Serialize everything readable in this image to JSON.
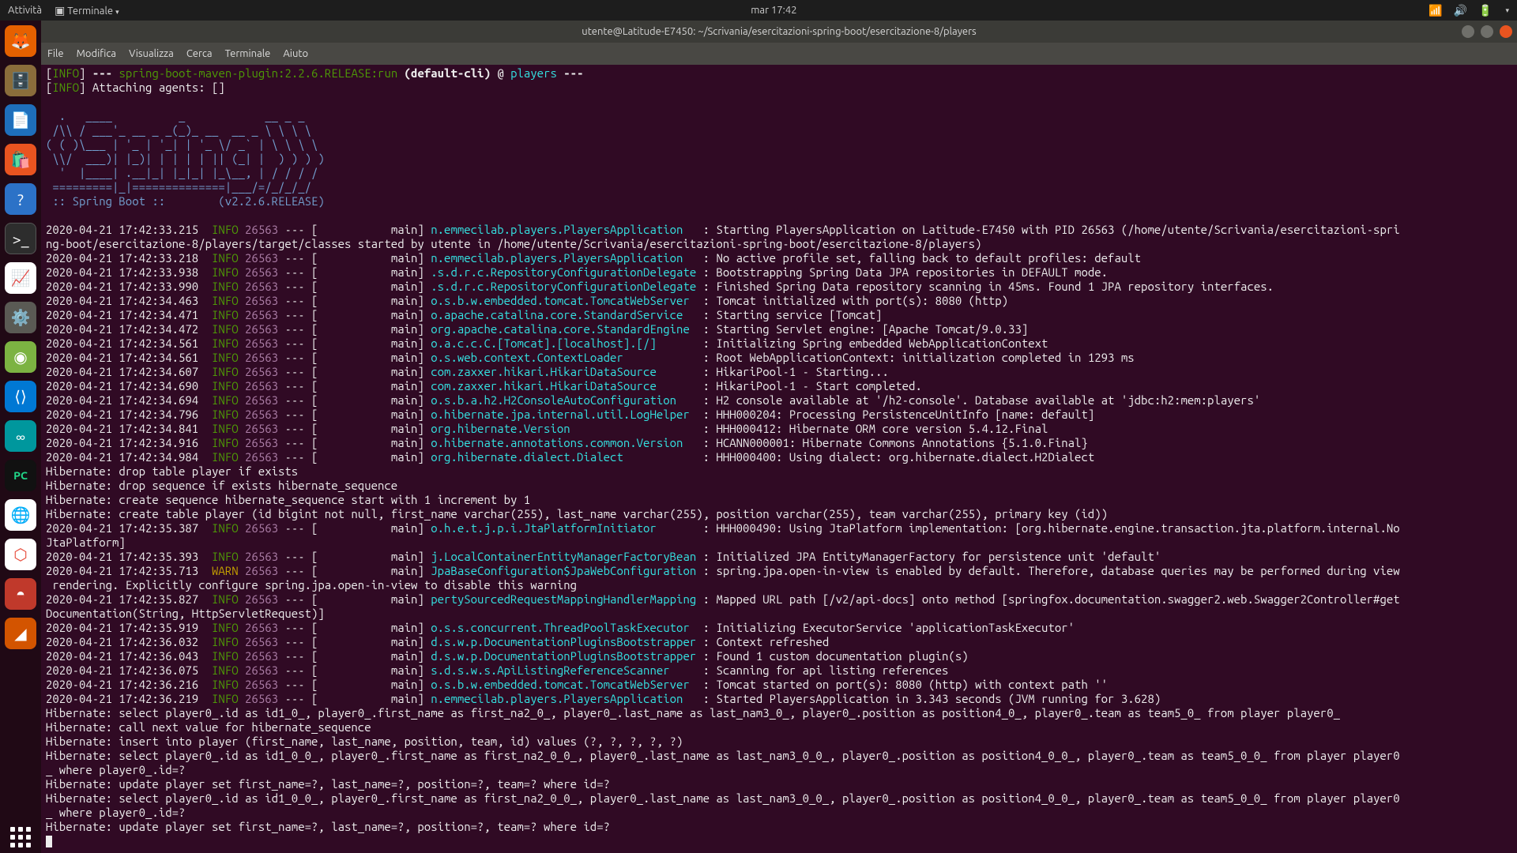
{
  "topbar": {
    "activities": "Attività",
    "terminal": "Terminale",
    "clock": "mar 17:42"
  },
  "dock": {
    "firefox": "firefox-icon",
    "files": "files-icon",
    "libreoffice": "libreoffice-writer-icon",
    "software": "ubuntu-software-icon",
    "help": "help-icon",
    "terminal": "terminal-icon",
    "monitor": "system-monitor-icon",
    "settings": "settings-icon",
    "green": "app-icon",
    "vscode": "vscode-icon",
    "arduino": "arduino-icon",
    "pycharm": "pycharm-icon",
    "chrome": "chrome-icon",
    "box": "app-icon-2",
    "red": "app-icon-3",
    "orange": "app-icon-4",
    "showapps": "show-applications-icon"
  },
  "window": {
    "title": "utente@Latitude-E7450: ~/Scrivania/esercitazioni-spring-boot/esercitazione-8/players",
    "controls": {
      "min": "−",
      "max": "□",
      "close": "×"
    }
  },
  "menubar": {
    "file": "File",
    "edit": "Modifica",
    "view": "Visualizza",
    "search": "Cerca",
    "terminal": "Terminale",
    "help": "Aiuto"
  },
  "term": {
    "l1a": "[",
    "l1b": "INFO",
    "l1c": "] ",
    "l1d": "--- ",
    "l1e": "spring-boot-maven-plugin:2.2.6.RELEASE:run",
    "l1f": " (default-cli)",
    "l1g": " @ ",
    "l1h": "players",
    "l1i": " ---",
    "l2a": "[",
    "l2b": "INFO",
    "l2c": "] Attaching agents: []",
    "banner": "\n  .   ____          _            __ _ _\n /\\\\ / ___'_ __ _ _(_)_ __  __ _ \\ \\ \\ \\\n( ( )\\___ | '_ | '_| | '_ \\/ _` | \\ \\ \\ \\\n \\\\/  ___)| |_)| | | | | || (_| |  ) ) ) )\n  '  |____| .__|_| |_|_| |_\\__, | / / / /\n =========|_|==============|___/=/_/_/_/",
    "bootline": " :: Spring Boot ::        (v2.2.6.RELEASE)",
    "lines": [
      {
        "ts": "2020-04-21 17:42:33.215",
        "lvl": "INFO",
        "pid": "26563",
        "th": " --- [           main] ",
        "log": "n.emmecilab.players.PlayersApplication   ",
        "msg": ": Starting PlayersApplication on Latitude-E7450 with PID 26563 (/home/utente/Scrivania/esercitazioni-spri"
      },
      {
        "plain": "ng-boot/esercitazione-8/players/target/classes started by utente in /home/utente/Scrivania/esercitazioni-spring-boot/esercitazione-8/players)"
      },
      {
        "ts": "2020-04-21 17:42:33.218",
        "lvl": "INFO",
        "pid": "26563",
        "th": " --- [           main] ",
        "log": "n.emmecilab.players.PlayersApplication   ",
        "msg": ": No active profile set, falling back to default profiles: default"
      },
      {
        "ts": "2020-04-21 17:42:33.938",
        "lvl": "INFO",
        "pid": "26563",
        "th": " --- [           main] ",
        "log": ".s.d.r.c.RepositoryConfigurationDelegate ",
        "msg": ": Bootstrapping Spring Data JPA repositories in DEFAULT mode."
      },
      {
        "ts": "2020-04-21 17:42:33.990",
        "lvl": "INFO",
        "pid": "26563",
        "th": " --- [           main] ",
        "log": ".s.d.r.c.RepositoryConfigurationDelegate ",
        "msg": ": Finished Spring Data repository scanning in 45ms. Found 1 JPA repository interfaces."
      },
      {
        "ts": "2020-04-21 17:42:34.463",
        "lvl": "INFO",
        "pid": "26563",
        "th": " --- [           main] ",
        "log": "o.s.b.w.embedded.tomcat.TomcatWebServer  ",
        "msg": ": Tomcat initialized with port(s): 8080 (http)"
      },
      {
        "ts": "2020-04-21 17:42:34.471",
        "lvl": "INFO",
        "pid": "26563",
        "th": " --- [           main] ",
        "log": "o.apache.catalina.core.StandardService   ",
        "msg": ": Starting service [Tomcat]"
      },
      {
        "ts": "2020-04-21 17:42:34.472",
        "lvl": "INFO",
        "pid": "26563",
        "th": " --- [           main] ",
        "log": "org.apache.catalina.core.StandardEngine  ",
        "msg": ": Starting Servlet engine: [Apache Tomcat/9.0.33]"
      },
      {
        "ts": "2020-04-21 17:42:34.561",
        "lvl": "INFO",
        "pid": "26563",
        "th": " --- [           main] ",
        "log": "o.a.c.c.C.[Tomcat].[localhost].[/]       ",
        "msg": ": Initializing Spring embedded WebApplicationContext"
      },
      {
        "ts": "2020-04-21 17:42:34.561",
        "lvl": "INFO",
        "pid": "26563",
        "th": " --- [           main] ",
        "log": "o.s.web.context.ContextLoader            ",
        "msg": ": Root WebApplicationContext: initialization completed in 1293 ms"
      },
      {
        "ts": "2020-04-21 17:42:34.607",
        "lvl": "INFO",
        "pid": "26563",
        "th": " --- [           main] ",
        "log": "com.zaxxer.hikari.HikariDataSource       ",
        "msg": ": HikariPool-1 - Starting..."
      },
      {
        "ts": "2020-04-21 17:42:34.690",
        "lvl": "INFO",
        "pid": "26563",
        "th": " --- [           main] ",
        "log": "com.zaxxer.hikari.HikariDataSource       ",
        "msg": ": HikariPool-1 - Start completed."
      },
      {
        "ts": "2020-04-21 17:42:34.694",
        "lvl": "INFO",
        "pid": "26563",
        "th": " --- [           main] ",
        "log": "o.s.b.a.h2.H2ConsoleAutoConfiguration    ",
        "msg": ": H2 console available at '/h2-console'. Database available at 'jdbc:h2:mem:players'"
      },
      {
        "ts": "2020-04-21 17:42:34.796",
        "lvl": "INFO",
        "pid": "26563",
        "th": " --- [           main] ",
        "log": "o.hibernate.jpa.internal.util.LogHelper  ",
        "msg": ": HHH000204: Processing PersistenceUnitInfo [name: default]"
      },
      {
        "ts": "2020-04-21 17:42:34.841",
        "lvl": "INFO",
        "pid": "26563",
        "th": " --- [           main] ",
        "log": "org.hibernate.Version                    ",
        "msg": ": HHH000412: Hibernate ORM core version 5.4.12.Final"
      },
      {
        "ts": "2020-04-21 17:42:34.916",
        "lvl": "INFO",
        "pid": "26563",
        "th": " --- [           main] ",
        "log": "o.hibernate.annotations.common.Version   ",
        "msg": ": HCANN000001: Hibernate Commons Annotations {5.1.0.Final}"
      },
      {
        "ts": "2020-04-21 17:42:34.984",
        "lvl": "INFO",
        "pid": "26563",
        "th": " --- [           main] ",
        "log": "org.hibernate.dialect.Dialect            ",
        "msg": ": HHH000400: Using dialect: org.hibernate.dialect.H2Dialect"
      },
      {
        "plain": "Hibernate: drop table player if exists"
      },
      {
        "plain": "Hibernate: drop sequence if exists hibernate_sequence"
      },
      {
        "plain": "Hibernate: create sequence hibernate_sequence start with 1 increment by 1"
      },
      {
        "plain": "Hibernate: create table player (id bigint not null, first_name varchar(255), last_name varchar(255), position varchar(255), team varchar(255), primary key (id))"
      },
      {
        "ts": "2020-04-21 17:42:35.387",
        "lvl": "INFO",
        "pid": "26563",
        "th": " --- [           main] ",
        "log": "o.h.e.t.j.p.i.JtaPlatformInitiator       ",
        "msg": ": HHH000490: Using JtaPlatform implementation: [org.hibernate.engine.transaction.jta.platform.internal.No"
      },
      {
        "plain": "JtaPlatform]"
      },
      {
        "ts": "2020-04-21 17:42:35.393",
        "lvl": "INFO",
        "pid": "26563",
        "th": " --- [           main] ",
        "log": "j.LocalContainerEntityManagerFactoryBean ",
        "msg": ": Initialized JPA EntityManagerFactory for persistence unit 'default'"
      },
      {
        "ts": "2020-04-21 17:42:35.713",
        "lvl": "WARN",
        "pid": "26563",
        "th": " --- [           main] ",
        "log": "JpaBaseConfiguration$JpaWebConfiguration ",
        "msg": ": spring.jpa.open-in-view is enabled by default. Therefore, database queries may be performed during view"
      },
      {
        "plain": " rendering. Explicitly configure spring.jpa.open-in-view to disable this warning"
      },
      {
        "ts": "2020-04-21 17:42:35.827",
        "lvl": "INFO",
        "pid": "26563",
        "th": " --- [           main] ",
        "log": "pertySourcedRequestMappingHandlerMapping ",
        "msg": ": Mapped URL path [/v2/api-docs] onto method [springfox.documentation.swagger2.web.Swagger2Controller#get"
      },
      {
        "plain": "Documentation(String, HttpServletRequest)]"
      },
      {
        "ts": "2020-04-21 17:42:35.919",
        "lvl": "INFO",
        "pid": "26563",
        "th": " --- [           main] ",
        "log": "o.s.s.concurrent.ThreadPoolTaskExecutor  ",
        "msg": ": Initializing ExecutorService 'applicationTaskExecutor'"
      },
      {
        "ts": "2020-04-21 17:42:36.032",
        "lvl": "INFO",
        "pid": "26563",
        "th": " --- [           main] ",
        "log": "d.s.w.p.DocumentationPluginsBootstrapper ",
        "msg": ": Context refreshed"
      },
      {
        "ts": "2020-04-21 17:42:36.043",
        "lvl": "INFO",
        "pid": "26563",
        "th": " --- [           main] ",
        "log": "d.s.w.p.DocumentationPluginsBootstrapper ",
        "msg": ": Found 1 custom documentation plugin(s)"
      },
      {
        "ts": "2020-04-21 17:42:36.075",
        "lvl": "INFO",
        "pid": "26563",
        "th": " --- [           main] ",
        "log": "s.d.s.w.s.ApiListingReferenceScanner     ",
        "msg": ": Scanning for api listing references"
      },
      {
        "ts": "2020-04-21 17:42:36.216",
        "lvl": "INFO",
        "pid": "26563",
        "th": " --- [           main] ",
        "log": "o.s.b.w.embedded.tomcat.TomcatWebServer  ",
        "msg": ": Tomcat started on port(s): 8080 (http) with context path ''"
      },
      {
        "ts": "2020-04-21 17:42:36.219",
        "lvl": "INFO",
        "pid": "26563",
        "th": " --- [           main] ",
        "log": "n.emmecilab.players.PlayersApplication   ",
        "msg": ": Started PlayersApplication in 3.343 seconds (JVM running for 3.628)"
      },
      {
        "plain": "Hibernate: select player0_.id as id1_0_, player0_.first_name as first_na2_0_, player0_.last_name as last_nam3_0_, player0_.position as position4_0_, player0_.team as team5_0_ from player player0_"
      },
      {
        "plain": "Hibernate: call next value for hibernate_sequence"
      },
      {
        "plain": "Hibernate: insert into player (first_name, last_name, position, team, id) values (?, ?, ?, ?, ?)"
      },
      {
        "plain": "Hibernate: select player0_.id as id1_0_0_, player0_.first_name as first_na2_0_0_, player0_.last_name as last_nam3_0_0_, player0_.position as position4_0_0_, player0_.team as team5_0_0_ from player player0"
      },
      {
        "plain": "_ where player0_.id=?"
      },
      {
        "plain": "Hibernate: update player set first_name=?, last_name=?, position=?, team=? where id=?"
      },
      {
        "plain": "Hibernate: select player0_.id as id1_0_0_, player0_.first_name as first_na2_0_0_, player0_.last_name as last_nam3_0_0_, player0_.position as position4_0_0_, player0_.team as team5_0_0_ from player player0"
      },
      {
        "plain": "_ where player0_.id=?"
      },
      {
        "plain": "Hibernate: update player set first_name=?, last_name=?, position=?, team=? where id=?"
      }
    ]
  }
}
